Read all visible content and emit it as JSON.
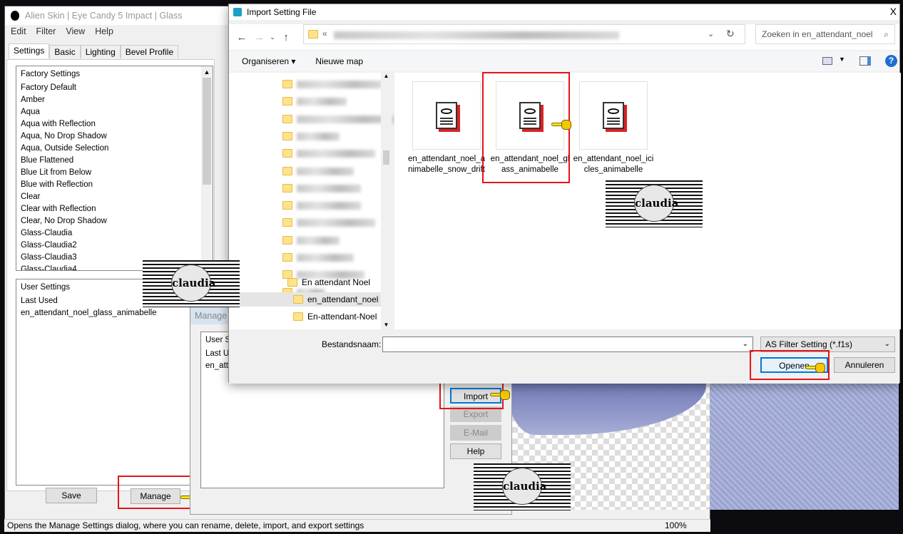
{
  "main_window": {
    "title": "Alien Skin | Eye Candy 5 Impact | Glass",
    "menu": [
      "Edit",
      "Filter",
      "View",
      "Help"
    ],
    "tabs": [
      "Settings",
      "Basic",
      "Lighting",
      "Bevel Profile"
    ],
    "active_tab": "Settings",
    "factory_settings": {
      "header": "Factory Settings",
      "items": [
        "Factory Default",
        "Amber",
        "Aqua",
        "Aqua with Reflection",
        "Aqua, No Drop Shadow",
        "Aqua, Outside Selection",
        "Blue Flattened",
        "Blue Lit from Below",
        "Blue with Reflection",
        "Clear",
        "Clear with Reflection",
        "Clear, No Drop Shadow",
        "Glass-Claudia",
        "Glass-Claudia2",
        "Glass-Claudia3",
        "Glass-Claudia4"
      ]
    },
    "user_settings": {
      "header": "User Settings",
      "items": [
        "Last Used",
        "en_attendant_noel_glass_animabelle"
      ]
    },
    "save_label": "Save",
    "manage_label": "Manage",
    "status_text": "Opens the Manage Settings dialog, where you can rename, delete, import, and export settings",
    "zoom": "100%"
  },
  "manage_dialog": {
    "title": "Manage",
    "list_header": "User S",
    "items": [
      "Last U",
      "en_att"
    ],
    "buttons": {
      "import": "Import",
      "export": "Export",
      "email": "E-Mail",
      "help": "Help"
    }
  },
  "import_dialog": {
    "title": "Import Setting File",
    "close": "X",
    "address_prefix": "«",
    "search_placeholder": "Zoeken in en_attendant_noel",
    "organize": "Organiseren ▾",
    "new_folder": "Nieuwe map",
    "tree": [
      {
        "label": "En attendant Noel",
        "selected": false
      },
      {
        "label": "en_attendant_noel",
        "selected": true
      },
      {
        "label": "En-attendant-Noel",
        "selected": false
      }
    ],
    "files": [
      {
        "name": "en_attendant_noel_animabelle_snow_drift",
        "highlighted": false
      },
      {
        "name": "en_attendant_noel_glass_animabelle",
        "highlighted": true
      },
      {
        "name": "en_attendant_noel_icicles_animabelle",
        "highlighted": false
      }
    ],
    "filename_label": "Bestandsnaam:",
    "filename_value": "",
    "filetype": "AS Filter Setting (*.f1s)",
    "open_label": "Openen",
    "cancel_label": "Annuleren"
  },
  "watermark": "claudia",
  "colors": {
    "highlight": "#e3141b",
    "accent": "#0078d7"
  }
}
